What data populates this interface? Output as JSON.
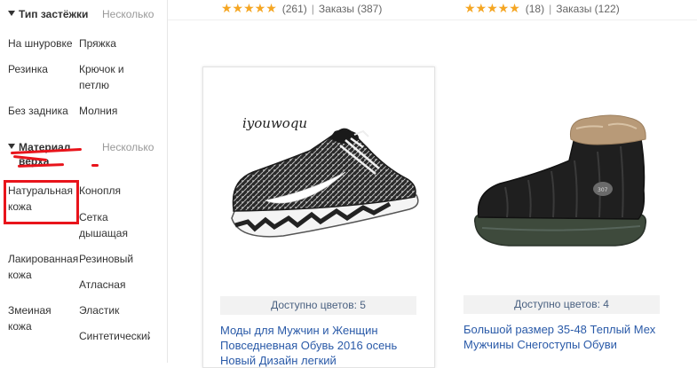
{
  "sidebar": {
    "groups": [
      {
        "title": "Тип застёжки",
        "multi": "Несколько",
        "options": [
          "На шнуровке",
          "Пряжка",
          "Резинка",
          "Крючок и петлю",
          "Без задника",
          "Молния"
        ]
      },
      {
        "title": "Материал верха",
        "multi": "Несколько",
        "options": [
          "Натуральная кожа",
          "Конопля",
          "Сетка дышащая",
          "Лакированная кожа",
          "Резиновый",
          "Атласная",
          "Змеиная кожа",
          "Эластик",
          "Синтетический"
        ]
      }
    ]
  },
  "top_ratings": [
    {
      "reviews": "(261)",
      "orders": "Заказы (387)"
    },
    {
      "reviews": "(18)",
      "orders": "Заказы (122)"
    }
  ],
  "products": [
    {
      "brand": "iyouwoqu",
      "colors": "Доступно цветов: 5",
      "title": "Моды для Мужчин и Женщин Повседневная Обувь 2016 осень Новый Дизайн легкий"
    },
    {
      "colors": "Доступно цветов: 4",
      "title": "Большой размер 35-48 Теплый Мех Мужчины Снегоступы Обуви"
    }
  ],
  "colors": {
    "link": "#2a5aa8",
    "star": "#f5a623",
    "annotation": "#e8141b"
  }
}
